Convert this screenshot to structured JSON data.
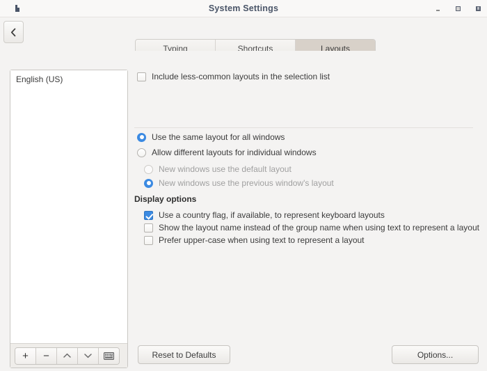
{
  "window": {
    "title": "System Settings",
    "icon": "app-icon",
    "controls": {
      "minimize": "minimize-button",
      "maximize": "maximize-button",
      "close": "close-button"
    }
  },
  "toolbar": {
    "back_label": "‹",
    "tabs": [
      {
        "label": "Typing",
        "active": false
      },
      {
        "label": "Shortcuts",
        "active": false
      },
      {
        "label": "Layouts",
        "active": true
      }
    ]
  },
  "layout_list": {
    "items": [
      {
        "label": "English (US)"
      }
    ],
    "buttons": [
      {
        "name": "add-layout-button",
        "glyph": "+"
      },
      {
        "name": "remove-layout-button",
        "glyph": "−"
      },
      {
        "name": "move-up-button",
        "glyph": "⌃"
      },
      {
        "name": "move-down-button",
        "glyph": "⌄"
      },
      {
        "name": "preview-layout-button",
        "glyph": "keyboard-icon"
      }
    ]
  },
  "options": {
    "include_less_common": {
      "label": "Include less-common layouts in the selection list",
      "checked": false
    },
    "scope_radios": [
      {
        "label": "Use the same layout for all windows",
        "selected": true,
        "disabled": false
      },
      {
        "label": "Allow different layouts for individual windows",
        "selected": false,
        "disabled": false
      }
    ],
    "nested_radios": [
      {
        "label": "New windows use the default layout",
        "selected": false,
        "disabled": true
      },
      {
        "label": "New windows use the previous window's layout",
        "selected": true,
        "disabled": true
      }
    ],
    "display_options_title": "Display options",
    "display_checkboxes": [
      {
        "label": "Use a country flag, if available,  to represent keyboard layouts",
        "checked": true
      },
      {
        "label": "Show the layout name instead of the group name when using text to represent a layout",
        "checked": false
      },
      {
        "label": "Prefer upper-case when using text to represent a layout",
        "checked": false
      }
    ]
  },
  "footer": {
    "reset_label": "Reset to Defaults",
    "options_label": "Options..."
  },
  "colors": {
    "accent": "#3b8ae2",
    "window_bg": "#f4f3f2",
    "title_text": "#4a5568",
    "active_tab": "#d8d1c9"
  }
}
